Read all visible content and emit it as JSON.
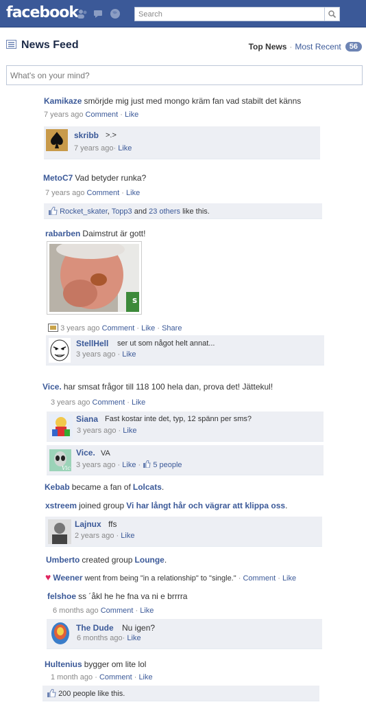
{
  "topbar": {
    "logo": "facebook",
    "search_placeholder": "Search"
  },
  "header": {
    "title": "News Feed",
    "top_news": "Top News",
    "sep": "·",
    "most_recent": "Most Recent",
    "count": "56"
  },
  "composer": {
    "placeholder": "What's on your mind?"
  },
  "common": {
    "comment": "Comment",
    "like": "Like",
    "share": "Share",
    "dot": "·"
  },
  "stories": [
    {
      "name": "Kamikaze",
      "text": "smörjde mig just med mongo kräm fan vad stabilt det känns",
      "time": "7 years ago",
      "comments": [
        {
          "name": "skribb",
          "text": ">.>",
          "time": "7 years ago"
        }
      ]
    },
    {
      "name": "MetoC7",
      "text": "Vad betyder runka?",
      "time": "7 years ago",
      "likes": {
        "a": "Rocket_skater",
        "b": "Topp3",
        "and": "and",
        "others": "23 others",
        "suffix": "like this."
      }
    },
    {
      "name": "rabarben",
      "text": "Daimstrut är gott!",
      "time": "3 years ago",
      "comments": [
        {
          "name": "StellHell",
          "text": "ser ut som något helt annat...",
          "time": "3 years ago"
        }
      ]
    },
    {
      "name": "Vice.",
      "text": "har smsat frågor till 118 100 hela dan, prova det! Jättekul!",
      "time": "3 years ago",
      "comments": [
        {
          "name": "Siana",
          "text": "Fast kostar inte det, typ, 12 spänn per sms?",
          "time": "3 years ago"
        },
        {
          "name": "Vice.",
          "text": "VA",
          "time": "3 years ago",
          "likes": "5 people"
        }
      ]
    },
    {
      "name": "Kebab",
      "text": "became a fan of",
      "object": "Lolcats",
      "end": "."
    },
    {
      "name": "xstreem",
      "text": "joined group",
      "object": "Vi har långt hår och vägrar att klippa oss",
      "end": ".",
      "comments": [
        {
          "name": "Lajnux",
          "text": "ffs",
          "time": "2 years ago"
        }
      ]
    },
    {
      "name": "Umberto",
      "text": "created group",
      "object": "Lounge",
      "end": "."
    },
    {
      "name": "Weener",
      "text": "went from being \"in a relationship\" to \"single.\""
    },
    {
      "name": "felshoe",
      "text": "ss ´åkl he he fna va ni e brrrra",
      "time": "6 months ago",
      "comments": [
        {
          "name": "The Dude",
          "text": "Nu igen?",
          "time": "6 months ago"
        }
      ]
    },
    {
      "name": "Hultenius",
      "text": "bygger om lite lol",
      "time": "1 month ago",
      "likes": "200 people like this."
    }
  ]
}
